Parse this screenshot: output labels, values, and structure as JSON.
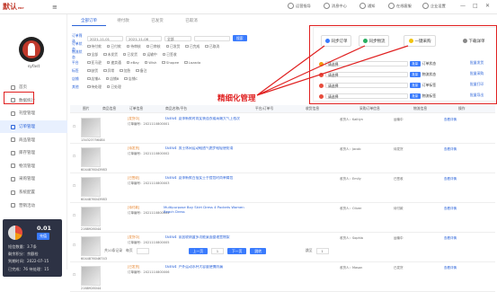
{
  "app": {
    "logo": "默认",
    "logo_sub": "ERP"
  },
  "topnav": {
    "items": [
      "运营指导",
      "消息中心",
      "通知",
      "在线客服",
      "企业设置"
    ]
  },
  "user": {
    "name": "syfast"
  },
  "sidebar": {
    "items": [
      "首页",
      "数据统计",
      "刊登管理",
      "订单管理",
      "商品管理",
      "库存管理",
      "物流管理",
      "采购管理",
      "系统配置",
      "营销活动"
    ]
  },
  "account": {
    "balance": "0.01",
    "charge": "充值",
    "lines": [
      "短信数量：3.7条",
      "剩余积分：余额检",
      "到期时间：2022-07-15",
      "已完成：76  待处理：15"
    ]
  },
  "tabs": [
    "全部订单",
    "待付款",
    "已发货",
    "已取消"
  ],
  "filter": {
    "row1_label": "订单筛选",
    "date_from": "2021-11-01",
    "date_to": "2021-11-08",
    "range": "全部",
    "search": "搜索",
    "row2_label": "订单状态",
    "row2_opts": [
      "待付款",
      "已付款",
      "待审核",
      "已审核",
      "已发货",
      "已完成",
      "已取消"
    ],
    "row3_label": "物流状态",
    "row3_opts": [
      "全部",
      "未发货",
      "已发货",
      "运输中",
      "已签收"
    ],
    "row4_label": "平台",
    "row4_opts": [
      "亚马逊",
      "速卖通",
      "eBay",
      "Wish",
      "Shopee",
      "Lazada"
    ],
    "row5_label": "标签",
    "row5_opts": [
      "缺货",
      "异常",
      "加急",
      "备注"
    ],
    "row6_label": "店铺",
    "row6_opts": [
      "店铺A",
      "店铺B",
      "店铺C"
    ],
    "row7_label": "其他",
    "row7_opts": [
      "待处理",
      "已处理"
    ]
  },
  "sync": {
    "btn1": "同步订单",
    "btn2": "同步物流",
    "btn3": "一键采购",
    "btn4": "下载详单",
    "rows": [
      {
        "select": "请选择",
        "action": "批量",
        "tip": "订单状态"
      },
      {
        "select": "请选择",
        "action": "批量",
        "tip": "物流状态"
      },
      {
        "select": "请选择",
        "action": "批量",
        "tip": "订单标签"
      },
      {
        "select": "请选择",
        "action": "批量",
        "tip": "物流标签"
      }
    ],
    "links": [
      "批量发货",
      "批量采购",
      "批量打印",
      "批量导出"
    ]
  },
  "annotation": "精细化管理",
  "table": {
    "headers": [
      "",
      "图片",
      "商品信息",
      "订单信息",
      "商品名称/平台",
      "平台/订单号",
      "收货信息",
      "采购订单信息",
      "物流信息",
      "操作"
    ],
    "rows": [
      {
        "sku": "134323756484",
        "tag": "[发货中]",
        "order": "订单编号：2021110800001",
        "title": "【NEW】夏季新款时尚女装连衣裙高端大气上档次",
        "buyer": "收货人：Kaitlyn",
        "ship": "运输中",
        "op": "查看详情"
      },
      {
        "sku": "6044876043983",
        "tag": "[待发货]",
        "order": "订单编号：2021110800002",
        "title": "【NEW】男士休闲运动鞋透气跑步鞋轻便防滑",
        "buyer": "收货人：Jacob",
        "ship": "待发货",
        "op": "查看详情"
      },
      {
        "sku": "6044876043983",
        "tag": "[已签收]",
        "order": "订单编号：2021110800003",
        "title": "【NEW】夏季新款百搭女士手提包时尚单肩包",
        "buyer": "收货人：Emily",
        "ship": "已签收",
        "op": "查看详情"
      },
      {
        "sku": "2168926044",
        "tag": "[待付款]",
        "order": "订单编号：2021110800004",
        "title": "Multipurpose Boy Skirt Dress 4 Pockets Women Beach Dress",
        "buyer": "收货人：Oliver",
        "ship": "待付款",
        "op": "查看详情"
      },
      {
        "sku": "6044876046743",
        "tag": "[发货中]",
        "order": "订单编号：2021110800005",
        "title": "【NEW】家居收纳盒多功能桌面整理置物架",
        "buyer": "收货人：Sophia",
        "ship": "运输中",
        "op": "查看详情"
      },
      {
        "sku": "2168926044",
        "tag": "[已发货]",
        "order": "订单编号：2021110800006",
        "title": "【NEW】户外运动水杯大容量便携防漏",
        "buyer": "收货人：Mason",
        "ship": "已发货",
        "op": "查看详情"
      }
    ]
  },
  "pager": {
    "total": "共10条记录",
    "per": "每页",
    "prev": "上一页",
    "page": "1",
    "next": "下一页",
    "jump": "跳转",
    "gopage": "跳至",
    "pages": "1"
  },
  "colors": {
    "accent": "#3a7bfd",
    "highlight": "#e02020",
    "sidebar_stats_bg": "#2d3244"
  }
}
